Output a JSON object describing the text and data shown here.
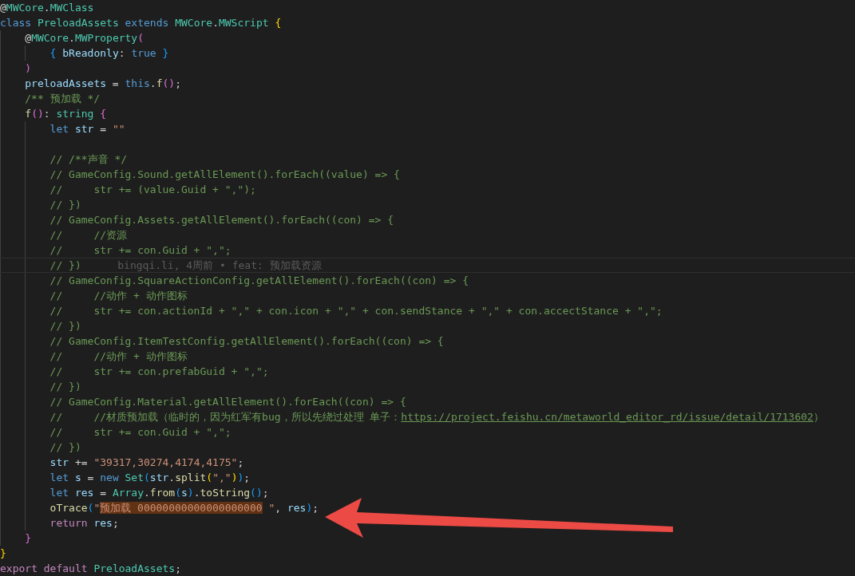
{
  "editor": {
    "lines": [
      {
        "tokens": [
          {
            "text": "@",
            "kind": "plain"
          },
          {
            "text": "MWCore",
            "kind": "type"
          },
          {
            "text": ".",
            "kind": "plain"
          },
          {
            "text": "MWClass",
            "kind": "type"
          }
        ]
      },
      {
        "tokens": [
          {
            "text": "class ",
            "kind": "keyword"
          },
          {
            "text": "PreloadAssets",
            "kind": "type"
          },
          {
            "text": " extends ",
            "kind": "keyword"
          },
          {
            "text": "MWCore",
            "kind": "type"
          },
          {
            "text": ".",
            "kind": "plain"
          },
          {
            "text": "MWScript",
            "kind": "type"
          },
          {
            "text": " {",
            "kind": "bracket1"
          }
        ]
      },
      {
        "tokens": [
          {
            "text": "    @",
            "kind": "plain"
          },
          {
            "text": "MWCore",
            "kind": "type"
          },
          {
            "text": ".",
            "kind": "plain"
          },
          {
            "text": "MWProperty",
            "kind": "type"
          },
          {
            "text": "(",
            "kind": "bracket2"
          }
        ]
      },
      {
        "tokens": [
          {
            "text": "        {",
            "kind": "bracket3"
          },
          {
            "text": " bReadonly",
            "kind": "variable"
          },
          {
            "text": ": ",
            "kind": "plain"
          },
          {
            "text": "true",
            "kind": "keyword"
          },
          {
            "text": " }",
            "kind": "bracket3"
          }
        ]
      },
      {
        "tokens": [
          {
            "text": "    )",
            "kind": "bracket2"
          }
        ]
      },
      {
        "tokens": [
          {
            "text": "    preloadAssets",
            "kind": "variable"
          },
          {
            "text": " = ",
            "kind": "plain"
          },
          {
            "text": "this",
            "kind": "keyword"
          },
          {
            "text": ".",
            "kind": "plain"
          },
          {
            "text": "f",
            "kind": "function"
          },
          {
            "text": "()",
            "kind": "bracket2"
          },
          {
            "text": ";",
            "kind": "plain"
          }
        ]
      },
      {
        "tokens": [
          {
            "text": "    /** 预加载 */",
            "kind": "comment"
          }
        ]
      },
      {
        "tokens": [
          {
            "text": "    f",
            "kind": "function"
          },
          {
            "text": "()",
            "kind": "bracket2"
          },
          {
            "text": ": ",
            "kind": "plain"
          },
          {
            "text": "string",
            "kind": "type"
          },
          {
            "text": " {",
            "kind": "bracket2"
          }
        ]
      },
      {
        "tokens": [
          {
            "text": "        let",
            "kind": "keyword"
          },
          {
            "text": " str",
            "kind": "variable"
          },
          {
            "text": " = ",
            "kind": "plain"
          },
          {
            "text": "\"\"",
            "kind": "string"
          }
        ]
      },
      {
        "kind": "blank"
      },
      {
        "tokens": [
          {
            "text": "        // /**声音 */",
            "kind": "comment"
          }
        ]
      },
      {
        "tokens": [
          {
            "text": "        // GameConfig.Sound.getAllElement().forEach((value) => {",
            "kind": "comment"
          }
        ]
      },
      {
        "tokens": [
          {
            "text": "        //     str += (value.Guid + \",\");",
            "kind": "comment"
          }
        ]
      },
      {
        "tokens": [
          {
            "text": "        // })",
            "kind": "comment"
          }
        ]
      },
      {
        "tokens": [
          {
            "text": "        // GameConfig.Assets.getAllElement().forEach((con) => {",
            "kind": "comment"
          }
        ]
      },
      {
        "tokens": [
          {
            "text": "        //     //资源",
            "kind": "comment"
          }
        ]
      },
      {
        "tokens": [
          {
            "text": "        //     str += con.Guid + \",\";",
            "kind": "comment"
          }
        ]
      },
      {
        "current": true,
        "tokens": [
          {
            "text": "        // })",
            "kind": "comment"
          }
        ],
        "blame": "bingqi.li, 4周前 • feat: 预加载资源"
      },
      {
        "tokens": [
          {
            "text": "        // GameConfig.SquareActionConfig.getAllElement().forEach((con) => {",
            "kind": "comment"
          }
        ]
      },
      {
        "tokens": [
          {
            "text": "        //     //动作 + 动作图标",
            "kind": "comment"
          }
        ]
      },
      {
        "tokens": [
          {
            "text": "        //     str += con.actionId + \",\" + con.icon + \",\" + con.sendStance + \",\" + con.accectStance + \",\";",
            "kind": "comment"
          }
        ]
      },
      {
        "tokens": [
          {
            "text": "        // })",
            "kind": "comment"
          }
        ]
      },
      {
        "tokens": [
          {
            "text": "        // GameConfig.ItemTestConfig.getAllElement().forEach((con) => {",
            "kind": "comment"
          }
        ]
      },
      {
        "tokens": [
          {
            "text": "        //     //动作 + 动作图标",
            "kind": "comment"
          }
        ]
      },
      {
        "tokens": [
          {
            "text": "        //     str += con.prefabGuid + \",\";",
            "kind": "comment"
          }
        ]
      },
      {
        "tokens": [
          {
            "text": "        // })",
            "kind": "comment"
          }
        ]
      },
      {
        "tokens": [
          {
            "text": "        // GameConfig.Material.getAllElement().forEach((con) => {",
            "kind": "comment"
          }
        ]
      },
      {
        "tokens": [
          {
            "text": "        //     //材质预加载（临时的，因为红军有bug，所以先绕过处理 单子：",
            "kind": "comment"
          },
          {
            "text": "https://project.feishu.cn/metaworld_editor_rd/issue/detail/1713602",
            "kind": "link"
          },
          {
            "text": "）",
            "kind": "comment"
          }
        ]
      },
      {
        "tokens": [
          {
            "text": "        //     str += con.Guid + \",\";",
            "kind": "comment"
          }
        ]
      },
      {
        "tokens": [
          {
            "text": "        // })",
            "kind": "comment"
          }
        ]
      },
      {
        "tokens": [
          {
            "text": "        str",
            "kind": "variable"
          },
          {
            "text": " += ",
            "kind": "plain"
          },
          {
            "text": "\"39317,30274,4174,4175\"",
            "kind": "string"
          },
          {
            "text": ";",
            "kind": "plain"
          }
        ]
      },
      {
        "tokens": [
          {
            "text": "        let",
            "kind": "keyword"
          },
          {
            "text": " s",
            "kind": "variable"
          },
          {
            "text": " = ",
            "kind": "plain"
          },
          {
            "text": "new ",
            "kind": "keyword"
          },
          {
            "text": "Set",
            "kind": "type"
          },
          {
            "text": "(",
            "kind": "bracket3"
          },
          {
            "text": "str",
            "kind": "variable"
          },
          {
            "text": ".",
            "kind": "plain"
          },
          {
            "text": "split",
            "kind": "function"
          },
          {
            "text": "(",
            "kind": "bracket1"
          },
          {
            "text": "\",\"",
            "kind": "string"
          },
          {
            "text": ")",
            "kind": "bracket1"
          },
          {
            "text": ")",
            "kind": "bracket3"
          },
          {
            "text": ";",
            "kind": "plain"
          }
        ]
      },
      {
        "tokens": [
          {
            "text": "        let",
            "kind": "keyword"
          },
          {
            "text": " res",
            "kind": "variable"
          },
          {
            "text": " = ",
            "kind": "plain"
          },
          {
            "text": "Array",
            "kind": "type"
          },
          {
            "text": ".",
            "kind": "plain"
          },
          {
            "text": "from",
            "kind": "function"
          },
          {
            "text": "(",
            "kind": "bracket3"
          },
          {
            "text": "s",
            "kind": "variable"
          },
          {
            "text": ")",
            "kind": "bracket3"
          },
          {
            "text": ".",
            "kind": "plain"
          },
          {
            "text": "toString",
            "kind": "function"
          },
          {
            "text": "()",
            "kind": "bracket3"
          },
          {
            "text": ";",
            "kind": "plain"
          }
        ]
      },
      {
        "tokens": [
          {
            "text": "        oTrace",
            "kind": "function"
          },
          {
            "text": "(",
            "kind": "bracket3"
          },
          {
            "text": "\"",
            "kind": "string"
          },
          {
            "text": "预加载 00000000000000000000",
            "kind": "string",
            "highlighted": true
          },
          {
            "text": " \"",
            "kind": "string"
          },
          {
            "text": ", ",
            "kind": "plain"
          },
          {
            "text": "res",
            "kind": "variable"
          },
          {
            "text": ")",
            "kind": "bracket3"
          },
          {
            "text": ";",
            "kind": "plain"
          }
        ]
      },
      {
        "tokens": [
          {
            "text": "        return",
            "kind": "control"
          },
          {
            "text": " res",
            "kind": "variable"
          },
          {
            "text": ";",
            "kind": "plain"
          }
        ]
      },
      {
        "tokens": [
          {
            "text": "    }",
            "kind": "bracket2"
          }
        ]
      },
      {
        "tokens": [
          {
            "text": "}",
            "kind": "bracket1"
          }
        ]
      },
      {
        "tokens": [
          {
            "text": "export default ",
            "kind": "control"
          },
          {
            "text": "PreloadAssets",
            "kind": "type"
          },
          {
            "text": ";",
            "kind": "plain"
          }
        ]
      }
    ]
  }
}
